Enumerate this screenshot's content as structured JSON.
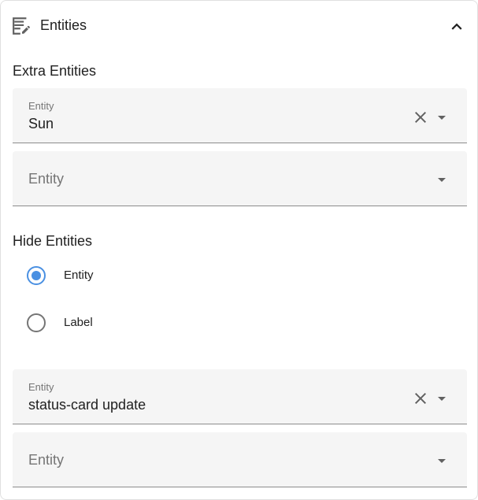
{
  "header": {
    "title": "Entities",
    "icon": "edit-note-icon",
    "collapse_icon": "chevron-up-icon"
  },
  "extra_entities": {
    "title": "Extra Entities",
    "fields": [
      {
        "label": "Entity",
        "value": "Sun"
      },
      {
        "placeholder": "Entity"
      }
    ]
  },
  "hide_entities": {
    "title": "Hide Entities",
    "options": [
      {
        "label": "Entity",
        "selected": true
      },
      {
        "label": "Label",
        "selected": false
      }
    ],
    "fields": [
      {
        "label": "Entity",
        "value": "status-card update"
      },
      {
        "placeholder": "Entity"
      }
    ]
  },
  "colors": {
    "accent": "#4a90e2",
    "field_bg": "#f5f5f5",
    "icon": "#616161",
    "muted_text": "#757575"
  }
}
